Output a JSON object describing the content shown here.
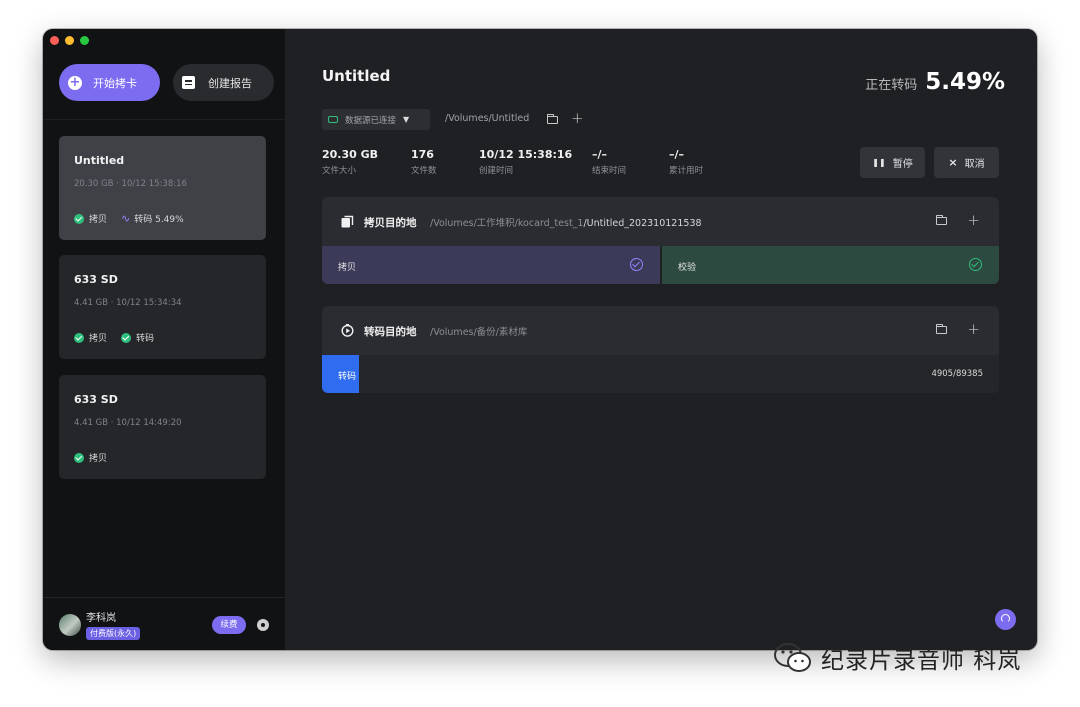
{
  "sidebar": {
    "start_button": "开始拷卡",
    "report_button": "创建报告",
    "cards": [
      {
        "title": "Untitled",
        "info": "20.30 GB · 10/12 15:38:16",
        "status_copy": "拷贝",
        "status_transcode": "转码 5.49%"
      },
      {
        "title": "633 SD",
        "info": "4.41 GB · 10/12 15:34:34",
        "status_copy": "拷贝",
        "status_transcode": "转码"
      },
      {
        "title": "633 SD",
        "info": "4.41 GB · 10/12 14:49:20",
        "status_copy": "拷贝"
      }
    ],
    "user": {
      "name": "李科岚",
      "plan": "付费版(永久)",
      "renew_label": "续费"
    }
  },
  "main": {
    "title": "Untitled",
    "progress_label": "正在转码",
    "progress_value": "5.49%",
    "source": {
      "status": "数据源已连接",
      "path": "/Volumes/Untitled"
    },
    "stats": [
      {
        "value": "20.30 GB",
        "label": "文件大小"
      },
      {
        "value": "176",
        "label": "文件数"
      },
      {
        "value": "10/12 15:38:16",
        "label": "创建时间"
      },
      {
        "value": "–/–",
        "label": "结束时间"
      },
      {
        "value": "–/–",
        "label": "累计用时"
      }
    ],
    "pause_label": "暂停",
    "cancel_label": "取消",
    "copy_dest": {
      "title": "拷贝目的地",
      "path_prefix": "/Volumes/工作堆积/kocard_test_1",
      "path_suffix": "/Untitled_202310121538",
      "step_copy": "拷贝",
      "step_verify": "校验"
    },
    "transcode_dest": {
      "title": "转码目的地",
      "path": "/Volumes/备份/素材库",
      "step": "转码",
      "count": "4905/89385",
      "progress": 0.055
    }
  },
  "watermark": "纪录片录音师 科岚",
  "colors": {
    "accent": "#7b6cf0",
    "success": "#2fbf7d",
    "transcode": "#2f6cf0",
    "copy_bg": "#3c3a5a",
    "verify_bg": "#2c4a3f"
  },
  "icons": [
    "plus-circle-icon",
    "document-icon",
    "check-circle-icon",
    "pulse-icon",
    "drive-icon",
    "caret-down-icon",
    "folder-icon",
    "plus-icon",
    "pause-icon",
    "close-icon",
    "copy-icon",
    "transcode-icon",
    "gear-icon",
    "headset-icon",
    "wechat-icon"
  ]
}
